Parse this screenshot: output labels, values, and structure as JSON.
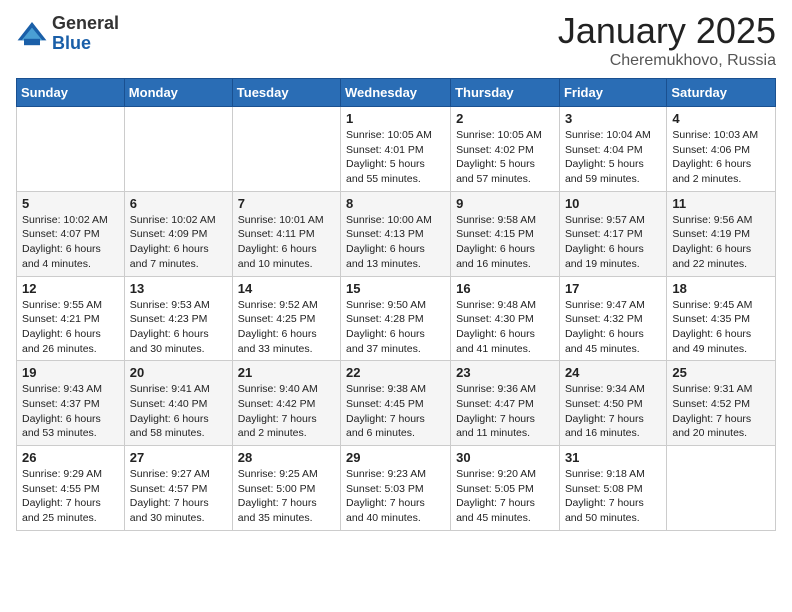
{
  "header": {
    "logo_general": "General",
    "logo_blue": "Blue",
    "month": "January 2025",
    "location": "Cheremukhovo, Russia"
  },
  "weekdays": [
    "Sunday",
    "Monday",
    "Tuesday",
    "Wednesday",
    "Thursday",
    "Friday",
    "Saturday"
  ],
  "weeks": [
    [
      {
        "day": "",
        "content": ""
      },
      {
        "day": "",
        "content": ""
      },
      {
        "day": "",
        "content": ""
      },
      {
        "day": "1",
        "content": "Sunrise: 10:05 AM\nSunset: 4:01 PM\nDaylight: 5 hours\nand 55 minutes."
      },
      {
        "day": "2",
        "content": "Sunrise: 10:05 AM\nSunset: 4:02 PM\nDaylight: 5 hours\nand 57 minutes."
      },
      {
        "day": "3",
        "content": "Sunrise: 10:04 AM\nSunset: 4:04 PM\nDaylight: 5 hours\nand 59 minutes."
      },
      {
        "day": "4",
        "content": "Sunrise: 10:03 AM\nSunset: 4:06 PM\nDaylight: 6 hours\nand 2 minutes."
      }
    ],
    [
      {
        "day": "5",
        "content": "Sunrise: 10:02 AM\nSunset: 4:07 PM\nDaylight: 6 hours\nand 4 minutes."
      },
      {
        "day": "6",
        "content": "Sunrise: 10:02 AM\nSunset: 4:09 PM\nDaylight: 6 hours\nand 7 minutes."
      },
      {
        "day": "7",
        "content": "Sunrise: 10:01 AM\nSunset: 4:11 PM\nDaylight: 6 hours\nand 10 minutes."
      },
      {
        "day": "8",
        "content": "Sunrise: 10:00 AM\nSunset: 4:13 PM\nDaylight: 6 hours\nand 13 minutes."
      },
      {
        "day": "9",
        "content": "Sunrise: 9:58 AM\nSunset: 4:15 PM\nDaylight: 6 hours\nand 16 minutes."
      },
      {
        "day": "10",
        "content": "Sunrise: 9:57 AM\nSunset: 4:17 PM\nDaylight: 6 hours\nand 19 minutes."
      },
      {
        "day": "11",
        "content": "Sunrise: 9:56 AM\nSunset: 4:19 PM\nDaylight: 6 hours\nand 22 minutes."
      }
    ],
    [
      {
        "day": "12",
        "content": "Sunrise: 9:55 AM\nSunset: 4:21 PM\nDaylight: 6 hours\nand 26 minutes."
      },
      {
        "day": "13",
        "content": "Sunrise: 9:53 AM\nSunset: 4:23 PM\nDaylight: 6 hours\nand 30 minutes."
      },
      {
        "day": "14",
        "content": "Sunrise: 9:52 AM\nSunset: 4:25 PM\nDaylight: 6 hours\nand 33 minutes."
      },
      {
        "day": "15",
        "content": "Sunrise: 9:50 AM\nSunset: 4:28 PM\nDaylight: 6 hours\nand 37 minutes."
      },
      {
        "day": "16",
        "content": "Sunrise: 9:48 AM\nSunset: 4:30 PM\nDaylight: 6 hours\nand 41 minutes."
      },
      {
        "day": "17",
        "content": "Sunrise: 9:47 AM\nSunset: 4:32 PM\nDaylight: 6 hours\nand 45 minutes."
      },
      {
        "day": "18",
        "content": "Sunrise: 9:45 AM\nSunset: 4:35 PM\nDaylight: 6 hours\nand 49 minutes."
      }
    ],
    [
      {
        "day": "19",
        "content": "Sunrise: 9:43 AM\nSunset: 4:37 PM\nDaylight: 6 hours\nand 53 minutes."
      },
      {
        "day": "20",
        "content": "Sunrise: 9:41 AM\nSunset: 4:40 PM\nDaylight: 6 hours\nand 58 minutes."
      },
      {
        "day": "21",
        "content": "Sunrise: 9:40 AM\nSunset: 4:42 PM\nDaylight: 7 hours\nand 2 minutes."
      },
      {
        "day": "22",
        "content": "Sunrise: 9:38 AM\nSunset: 4:45 PM\nDaylight: 7 hours\nand 6 minutes."
      },
      {
        "day": "23",
        "content": "Sunrise: 9:36 AM\nSunset: 4:47 PM\nDaylight: 7 hours\nand 11 minutes."
      },
      {
        "day": "24",
        "content": "Sunrise: 9:34 AM\nSunset: 4:50 PM\nDaylight: 7 hours\nand 16 minutes."
      },
      {
        "day": "25",
        "content": "Sunrise: 9:31 AM\nSunset: 4:52 PM\nDaylight: 7 hours\nand 20 minutes."
      }
    ],
    [
      {
        "day": "26",
        "content": "Sunrise: 9:29 AM\nSunset: 4:55 PM\nDaylight: 7 hours\nand 25 minutes."
      },
      {
        "day": "27",
        "content": "Sunrise: 9:27 AM\nSunset: 4:57 PM\nDaylight: 7 hours\nand 30 minutes."
      },
      {
        "day": "28",
        "content": "Sunrise: 9:25 AM\nSunset: 5:00 PM\nDaylight: 7 hours\nand 35 minutes."
      },
      {
        "day": "29",
        "content": "Sunrise: 9:23 AM\nSunset: 5:03 PM\nDaylight: 7 hours\nand 40 minutes."
      },
      {
        "day": "30",
        "content": "Sunrise: 9:20 AM\nSunset: 5:05 PM\nDaylight: 7 hours\nand 45 minutes."
      },
      {
        "day": "31",
        "content": "Sunrise: 9:18 AM\nSunset: 5:08 PM\nDaylight: 7 hours\nand 50 minutes."
      },
      {
        "day": "",
        "content": ""
      }
    ]
  ]
}
